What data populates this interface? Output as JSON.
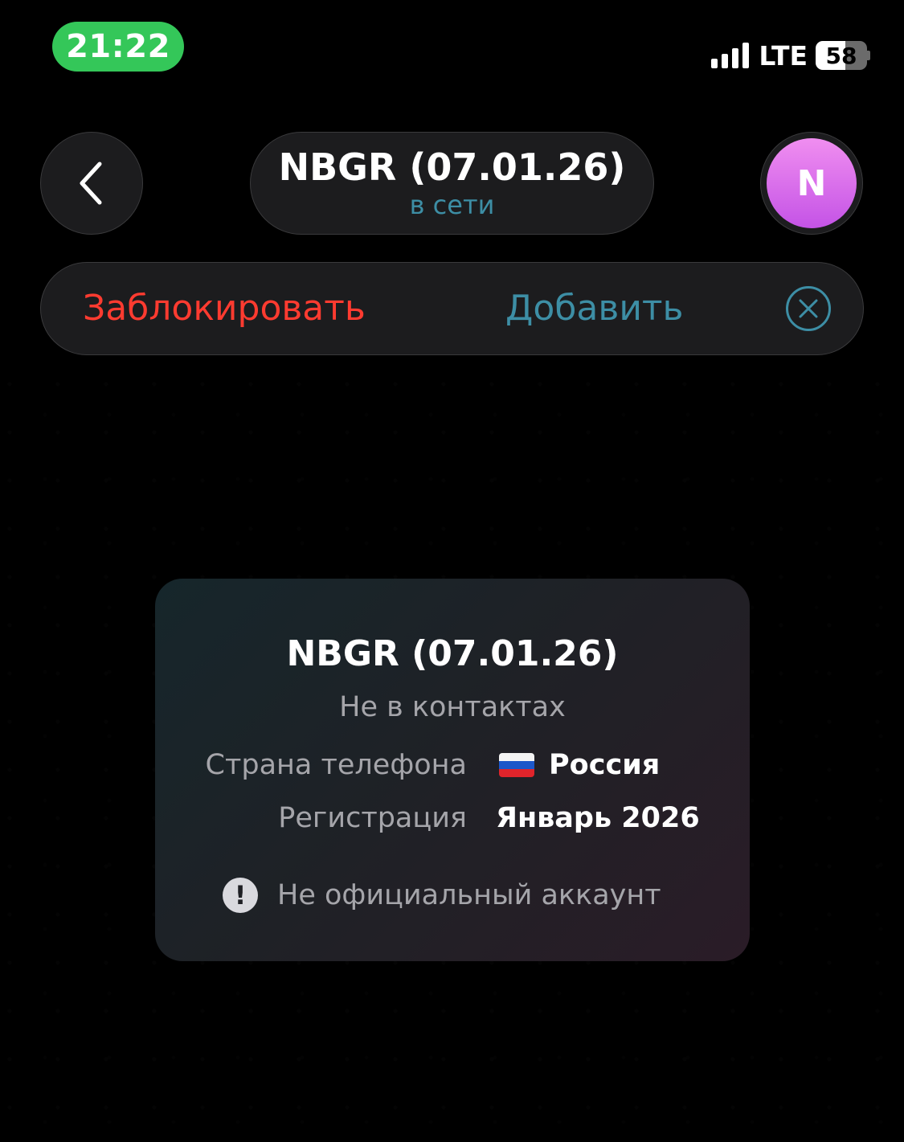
{
  "status_bar": {
    "time": "21:22",
    "network": "LTE",
    "battery": "58",
    "battery_level_percent": 58,
    "time_pill_color": "#34c759"
  },
  "header": {
    "back_icon": "chevron-left-icon",
    "title": "NBGR (07.01.26)",
    "status": "в сети",
    "avatar_letter": "N"
  },
  "action_bar": {
    "block_label": "Заблокировать",
    "add_label": "Добавить",
    "close_icon": "close-circle-icon"
  },
  "info_card": {
    "title": "NBGR (07.01.26)",
    "subtitle": "Не в контактах",
    "rows": [
      {
        "label": "Страна телефона",
        "value": "Россия",
        "flag": "russia-flag-icon"
      },
      {
        "label": "Регистрация",
        "value": "Январь 2026"
      }
    ],
    "warning": {
      "icon": "exclamation-circle-icon",
      "text": "Не официальный аккаунт"
    }
  },
  "colors": {
    "accent": "#3d8ea5",
    "danger": "#ff3b30",
    "avatar_gradient_top": "#f08ef0",
    "avatar_gradient_bottom": "#c453e6"
  }
}
